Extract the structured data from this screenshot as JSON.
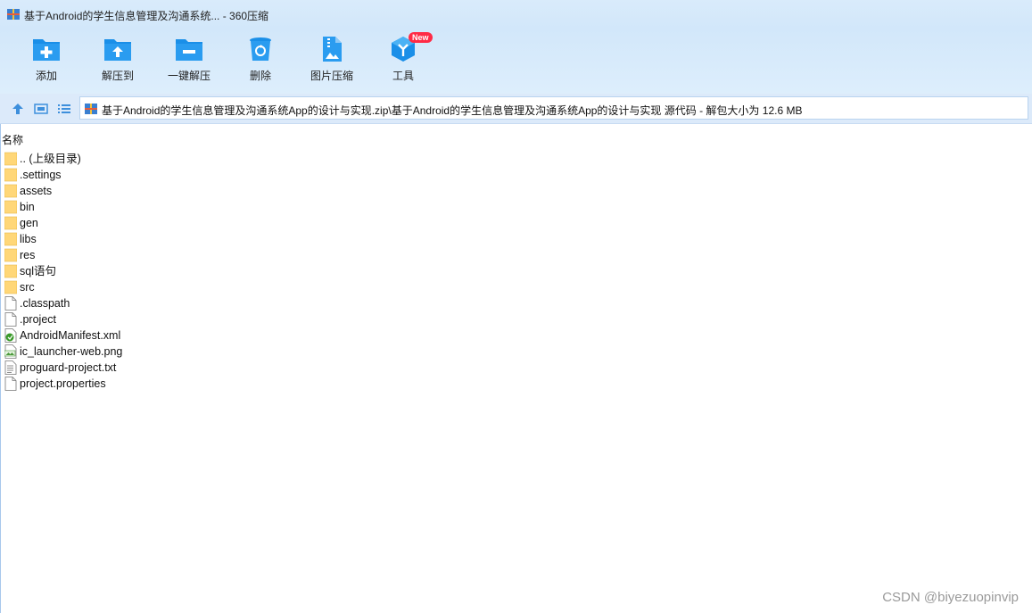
{
  "window": {
    "title": "基于Android的学生信息管理及沟通系统... - 360压缩",
    "app_icon": "archive-icon"
  },
  "toolbar": {
    "items": [
      {
        "label": "添加",
        "icon": "add-folder-icon"
      },
      {
        "label": "解压到",
        "icon": "extract-to-icon"
      },
      {
        "label": "一键解压",
        "icon": "one-click-extract-icon"
      },
      {
        "label": "删除",
        "icon": "recycle-bin-icon"
      },
      {
        "label": "图片压缩",
        "icon": "image-compress-icon"
      },
      {
        "label": "工具",
        "icon": "tools-icon",
        "badge": "New"
      }
    ]
  },
  "addressbar": {
    "path": "基于Android的学生信息管理及沟通系统App的设计与实现.zip\\基于Android的学生信息管理及沟通系统App的设计与实现 源代码 - 解包大小为 12.6 MB"
  },
  "filelist": {
    "column_name": "名称",
    "items": [
      {
        "name": ".. (上级目录)",
        "type": "folder"
      },
      {
        "name": ".settings",
        "type": "folder"
      },
      {
        "name": "assets",
        "type": "folder"
      },
      {
        "name": "bin",
        "type": "folder"
      },
      {
        "name": "gen",
        "type": "folder"
      },
      {
        "name": "libs",
        "type": "folder"
      },
      {
        "name": "res",
        "type": "folder"
      },
      {
        "name": "sql语句",
        "type": "folder"
      },
      {
        "name": "src",
        "type": "folder"
      },
      {
        "name": ".classpath",
        "type": "file"
      },
      {
        "name": ".project",
        "type": "file"
      },
      {
        "name": "AndroidManifest.xml",
        "type": "xml"
      },
      {
        "name": "ic_launcher-web.png",
        "type": "png"
      },
      {
        "name": "proguard-project.txt",
        "type": "txt"
      },
      {
        "name": "project.properties",
        "type": "file"
      }
    ]
  },
  "watermark": "CSDN @biyezuopinvip",
  "colors": {
    "accent": "#1a8fe8",
    "toolbar_bg": "#d2e7fa",
    "folder": "#ffd778"
  }
}
